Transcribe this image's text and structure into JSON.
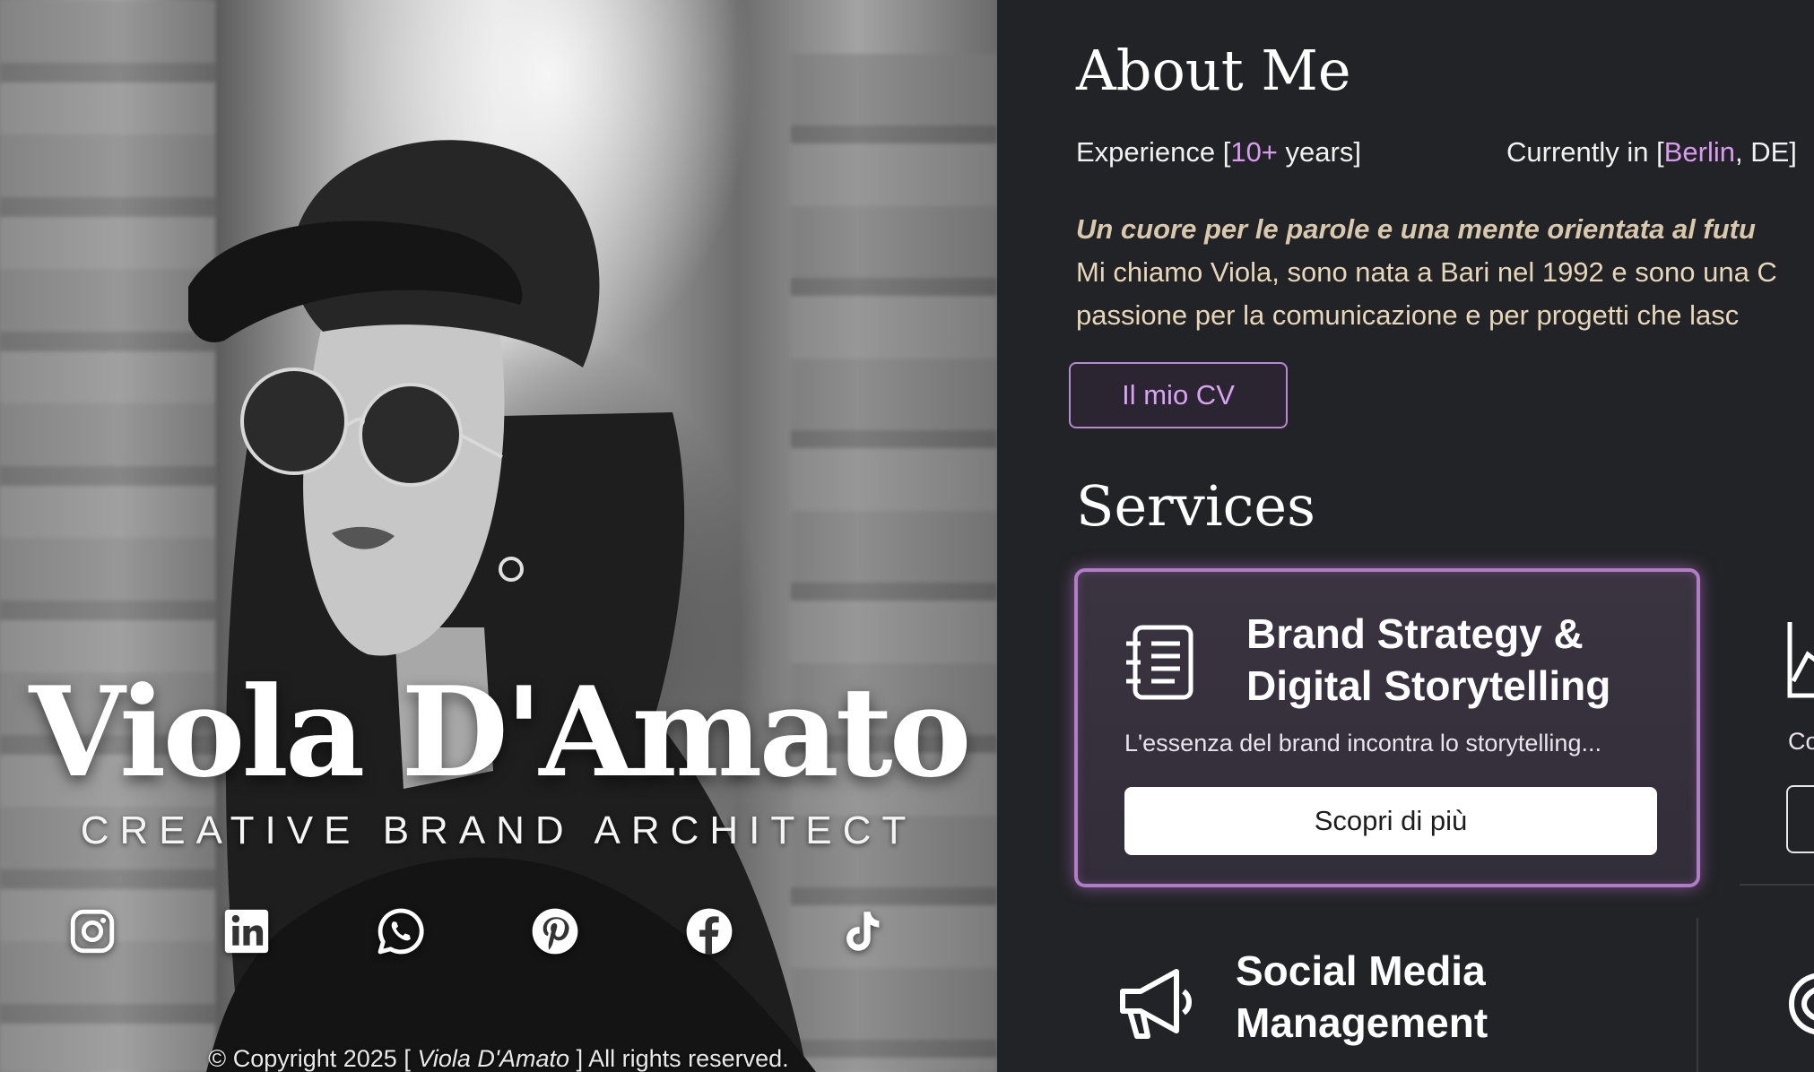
{
  "hero": {
    "name": "Viola D'Amato",
    "role": "CREATIVE BRAND ARCHITECT",
    "socials": [
      {
        "icon": "instagram-icon"
      },
      {
        "icon": "linkedin-icon"
      },
      {
        "icon": "whatsapp-icon"
      },
      {
        "icon": "pinterest-icon"
      },
      {
        "icon": "facebook-icon"
      },
      {
        "icon": "tiktok-icon"
      }
    ],
    "copyright": {
      "prefix": "© Copyright 2025 [ ",
      "name": "Viola D'Amato",
      "suffix": " ] All rights reserved."
    }
  },
  "about": {
    "heading": "About Me",
    "experience": {
      "label": "Experience [",
      "value": "10+",
      "suffix": " years]"
    },
    "location": {
      "label": "Currently in [",
      "city": "Berlin",
      "suffix": ", DE]"
    },
    "lead": "Un cuore per le parole e una mente orientata al futu",
    "line1": "Mi chiamo Viola, sono nata a Bari nel 1992 e sono una C",
    "line2": "passione per la comunicazione e per progetti che lasc",
    "cv_button": "Il mio CV"
  },
  "services": {
    "heading": "Services",
    "items": [
      {
        "title_line1": "Brand Strategy &",
        "title_line2": "Digital Storytelling",
        "description": "L'essenza del brand incontra lo storytelling...",
        "button": "Scopri di più",
        "icon": "document-list-icon"
      },
      {
        "title_line1": "Social Media",
        "title_line2": "Management",
        "icon": "megaphone-icon"
      }
    ],
    "peek_text": "Co"
  },
  "colors": {
    "background": "#222326",
    "accent": "#d99bf0",
    "card_border": "#b27cc6",
    "intro_text": "#e6d7b8"
  }
}
